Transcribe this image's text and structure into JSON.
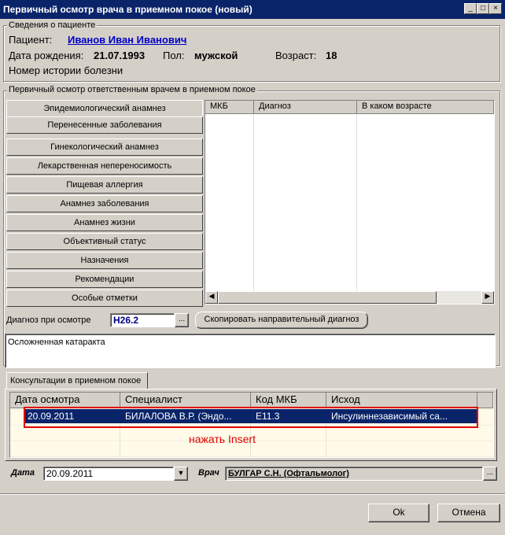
{
  "window": {
    "title": "Первичный осмотр врача в приемном покое (новый)"
  },
  "patient": {
    "legend": "Сведения о пациенте",
    "patient_label": "Пациент:",
    "patient_name": "Иванов Иван Иванович",
    "dob_label": "Дата рождения:",
    "dob_value": "21.07.1993",
    "sex_label": "Пол:",
    "sex_value": "мужской",
    "age_label": "Возраст:",
    "age_value": "18",
    "history_label": "Номер истории болезни"
  },
  "exam": {
    "legend": "Первичный осмотр ответственным врачем в приемном покое",
    "tabs": [
      {
        "label": "Эпидемиологический анамнез"
      },
      {
        "label": "Перенесенные заболевания"
      },
      {
        "label": "Гинекологический анамнез"
      },
      {
        "label": "Лекарственная непереносимость"
      },
      {
        "label": "Пищевая аллергия"
      },
      {
        "label": "Анамнез заболевания"
      },
      {
        "label": "Анамнез жизни"
      },
      {
        "label": "Объективный статус"
      },
      {
        "label": "Назначения"
      },
      {
        "label": "Рекомендации"
      },
      {
        "label": "Особые отметки"
      }
    ],
    "grid_columns": [
      "МКБ",
      "Диагноз",
      "В каком возрасте"
    ],
    "diag_label": "Диагноз при осмотре",
    "diag_value": "H26.2",
    "copy_button": "Скопировать направительный диагноз",
    "diag_text": "Осложненная катаракта"
  },
  "consult": {
    "tab_label": "Консультации в приемном покое",
    "columns": [
      "Дата осмотра",
      "Специалист",
      "Код МКБ",
      "Исход"
    ],
    "rows": [
      {
        "date": "20.09.2011",
        "specialist": "БИЛАЛОВА В.Р. (Эндо...",
        "code": "E11.3",
        "outcome": "Инсулиннезависимый са..."
      }
    ],
    "hint": "нажать Insert"
  },
  "footer": {
    "date_label": "Дата",
    "date_value": "20.09.2011",
    "doctor_label": "Врач",
    "doctor_value": "БУЛГАР С.Н. (Офтальмолог)",
    "ok_label": "Ok",
    "cancel_label": "Отмена"
  },
  "colors": {
    "title_bg": "#0a246a",
    "selection": "#0a246a",
    "hint_red": "#e00000",
    "link": "#0000c8"
  }
}
